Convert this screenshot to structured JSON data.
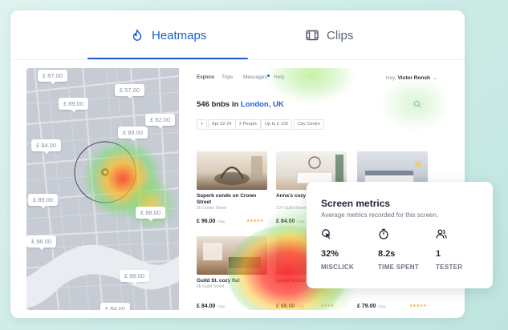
{
  "tabs": [
    {
      "label": "Heatmaps",
      "icon": "flame-icon",
      "active": true
    },
    {
      "label": "Clips",
      "icon": "film-icon",
      "active": false
    }
  ],
  "map": {
    "prices": [
      "£ 87.00",
      "£ 57.00",
      "£ 89.00",
      "£ 82.00",
      "£ 84.00",
      "£ 89.00",
      "£ 89.00",
      "£ 88.00",
      "£ 96.00",
      "£ 99.00",
      "£ 84.00"
    ]
  },
  "app": {
    "nav": [
      "Explore",
      "Trips",
      "Messages",
      "Help"
    ],
    "user_greeting": "Hey,",
    "user_name": "Victor Ronsh",
    "heading_prefix": "546 bnbs in ",
    "heading_location": "London, UK",
    "filters": [
      "+",
      "Apr 22-24",
      "2 People",
      "Up to £ 100",
      "City Centre"
    ],
    "listings": [
      {
        "title": "Superb condo on Crown Street",
        "sub": "2b Crown Street",
        "price": "£ 96.00",
        "per": "/ day",
        "stars": "★★★★★"
      },
      {
        "title": "Anna's cozy flat London Cit",
        "sub": "107 Guild Street",
        "price": "£ 84.00",
        "per": "/ day",
        "stars": ""
      },
      {
        "title": "",
        "sub": "",
        "price": "",
        "per": "",
        "stars": ""
      },
      {
        "title": "Guild St. cozy flat",
        "sub": "6b Guild Street",
        "price": "£ 84.00",
        "per": "/ day",
        "stars": ""
      },
      {
        "title": "Large Balco Bedroom",
        "sub": "",
        "price": "£ 68.00",
        "per": "/ day",
        "stars": "★★★★"
      },
      {
        "title": "",
        "sub": "",
        "price": "£ 79.00",
        "per": "/ day",
        "stars": "★★★★★"
      }
    ]
  },
  "metrics": {
    "title": "Screen metrics",
    "subtitle": "Average metrics recorded for this screen.",
    "items": [
      {
        "icon": "cursor-click-icon",
        "value": "32%",
        "label": "MISCLICK"
      },
      {
        "icon": "stopwatch-icon",
        "value": "8.2s",
        "label": "TIME SPENT"
      },
      {
        "icon": "users-icon",
        "value": "1",
        "label": "TESTER"
      }
    ]
  },
  "colors": {
    "accent": "#1f5fd6",
    "star": "#f3a825",
    "background": "#cfece7"
  }
}
